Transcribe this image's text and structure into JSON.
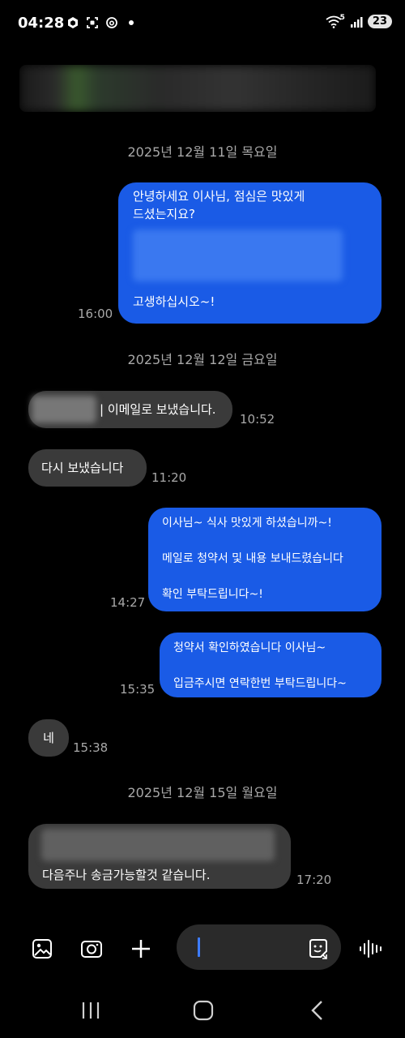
{
  "status_bar": {
    "time": "04:28",
    "battery": "23",
    "network_label": "5"
  },
  "dates": [
    "2025년 12월 11일 목요일",
    "2025년 12월 12일 금요일",
    "2025년 12월 15일 월요일"
  ],
  "messages": [
    {
      "lines": [
        "안녕하세요 이사님, 점심은 맛있게",
        "드셨는지요?",
        "고생하십시오~!"
      ],
      "time": "16:00"
    },
    {
      "text": "| 이메일로 보냈습니다.",
      "time": "10:52"
    },
    {
      "text": "다시 보냈습니다",
      "time": "11:20"
    },
    {
      "lines": [
        "이사님~ 식사 맛있게 하셨습니까~!",
        "메일로 청약서 및 내용 보내드렸습니다",
        "확인 부탁드립니다~!"
      ],
      "time": "14:27"
    },
    {
      "lines": [
        "청약서 확인하였습니다 이사님~",
        "입금주시면 연락한번 부탁드립니다~"
      ],
      "time": "15:35"
    },
    {
      "text": "네",
      "time": "15:38"
    },
    {
      "text": "다음주나 송금가능할것 같습니다.",
      "time": "17:20"
    }
  ],
  "composer": {
    "placeholder": ""
  },
  "colors": {
    "sent_bubble": "#1a5be6",
    "received_bubble": "#3a3a3a",
    "background": "#000000",
    "cursor": "#3d7cff"
  },
  "icons": [
    "gallery-icon",
    "camera-icon",
    "plus-icon",
    "emoji-sticker-icon",
    "voice-icon",
    "recents-nav-icon",
    "home-nav-icon",
    "back-nav-icon"
  ]
}
